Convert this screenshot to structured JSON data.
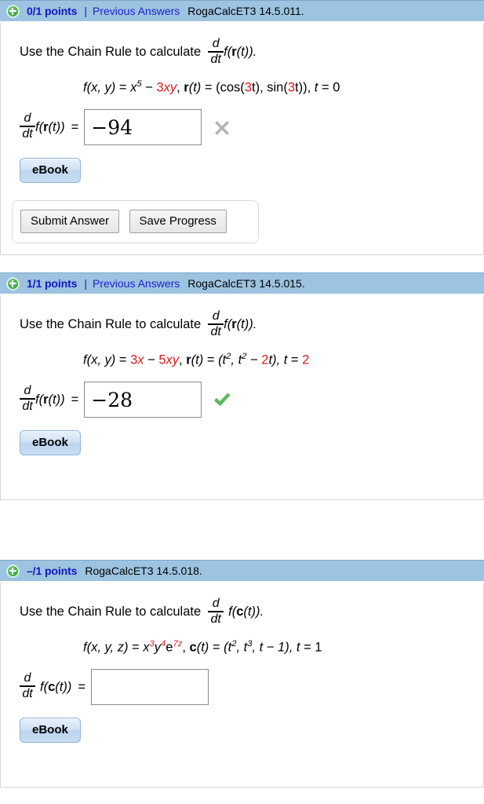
{
  "icons": {
    "plus": "plus-circle-icon",
    "incorrect": "x-mark-icon",
    "correct": "check-mark-icon"
  },
  "colors": {
    "header_bg": "#9cc3e0",
    "points_text": "#1616bf",
    "link": "#1f1fd0",
    "math_accent": "#e01b1b",
    "correct": "#5cb85c",
    "incorrect": "#b5b5b5"
  },
  "questions": [
    {
      "id": "q1",
      "header": {
        "points": "0/1 points",
        "separator": "|",
        "previous_answers": "Previous Answers",
        "reference": "RogaCalcET3 14.5.011."
      },
      "prompt": {
        "lead": "Use the Chain Rule to calculate",
        "derivative_num": "d",
        "derivative_den": "dt",
        "derivative_of": "f(r(t))."
      },
      "given": {
        "f_label": "f(x, y)",
        "equals": "=",
        "f_base": "x",
        "f_exp": "5",
        "minus": "−",
        "f_term2_coef": "3",
        "f_term2_vars": "xy",
        "r_label": "r(t)",
        "r_value_pre": "(cos(",
        "r_value_coef1": "3",
        "r_value_mid": "t), sin(",
        "r_value_coef2": "3",
        "r_value_post": "t)),",
        "t_label": "t",
        "t_value": "0"
      },
      "answer": {
        "label_num": "d",
        "label_den": "dt",
        "label_fn": "f(r(t))",
        "equals": "=",
        "value": "−94",
        "placeholder": "",
        "status": "incorrect"
      },
      "ebook_label": "eBook",
      "has_submit_bar": true,
      "submit": {
        "submit_label": "Submit Answer",
        "save_label": "Save Progress"
      }
    },
    {
      "id": "q2",
      "header": {
        "points": "1/1 points",
        "separator": "|",
        "previous_answers": "Previous Answers",
        "reference": "RogaCalcET3 14.5.015."
      },
      "prompt": {
        "lead": "Use the Chain Rule to calculate",
        "derivative_num": "d",
        "derivative_den": "dt",
        "derivative_of": "f(r(t))."
      },
      "given": {
        "f_label": "f(x, y)",
        "equals": "=",
        "f_term1_coef": "3",
        "f_term1_vars": "x",
        "minus": "−",
        "f_term2_coef": "5",
        "f_term2_vars": "xy",
        "r_label": "r(t)",
        "r_value_pre": "(t",
        "r_exp1": "2",
        "r_mid": ", t",
        "r_exp2": "2",
        "r_minus": "−",
        "r_coef": "2",
        "r_post": "t),",
        "t_label": "t",
        "t_value": "2"
      },
      "answer": {
        "label_num": "d",
        "label_den": "dt",
        "label_fn": "f(r(t))",
        "equals": "=",
        "value": "−28",
        "placeholder": "",
        "status": "correct"
      },
      "ebook_label": "eBook",
      "has_submit_bar": false
    },
    {
      "id": "q3",
      "header": {
        "points": "–/1 points",
        "separator": "",
        "previous_answers": "",
        "reference": "RogaCalcET3 14.5.018."
      },
      "prompt": {
        "lead": "Use the Chain Rule to calculate",
        "derivative_num": "d",
        "derivative_den": "dt",
        "derivative_of": "f(c(t))."
      },
      "given": {
        "f_label": "f(x, y, z)",
        "equals": "=",
        "x_base": "x",
        "x_exp": "3",
        "y_base": "y",
        "y_exp": "4",
        "e_base": "e",
        "e_exp": "7z",
        "c_label": "c(t)",
        "c_pre": "(t",
        "c_exp1": "2",
        "c_mid": ", t",
        "c_exp2": "3",
        "c_tail": ", t − 1),",
        "t_label": "t",
        "t_value": "1"
      },
      "answer": {
        "label_num": "d",
        "label_den": "dt",
        "label_fn": "f(c(t))",
        "equals": "=",
        "value": "",
        "placeholder": "",
        "status": "none"
      },
      "ebook_label": "eBook",
      "has_submit_bar": false
    }
  ]
}
